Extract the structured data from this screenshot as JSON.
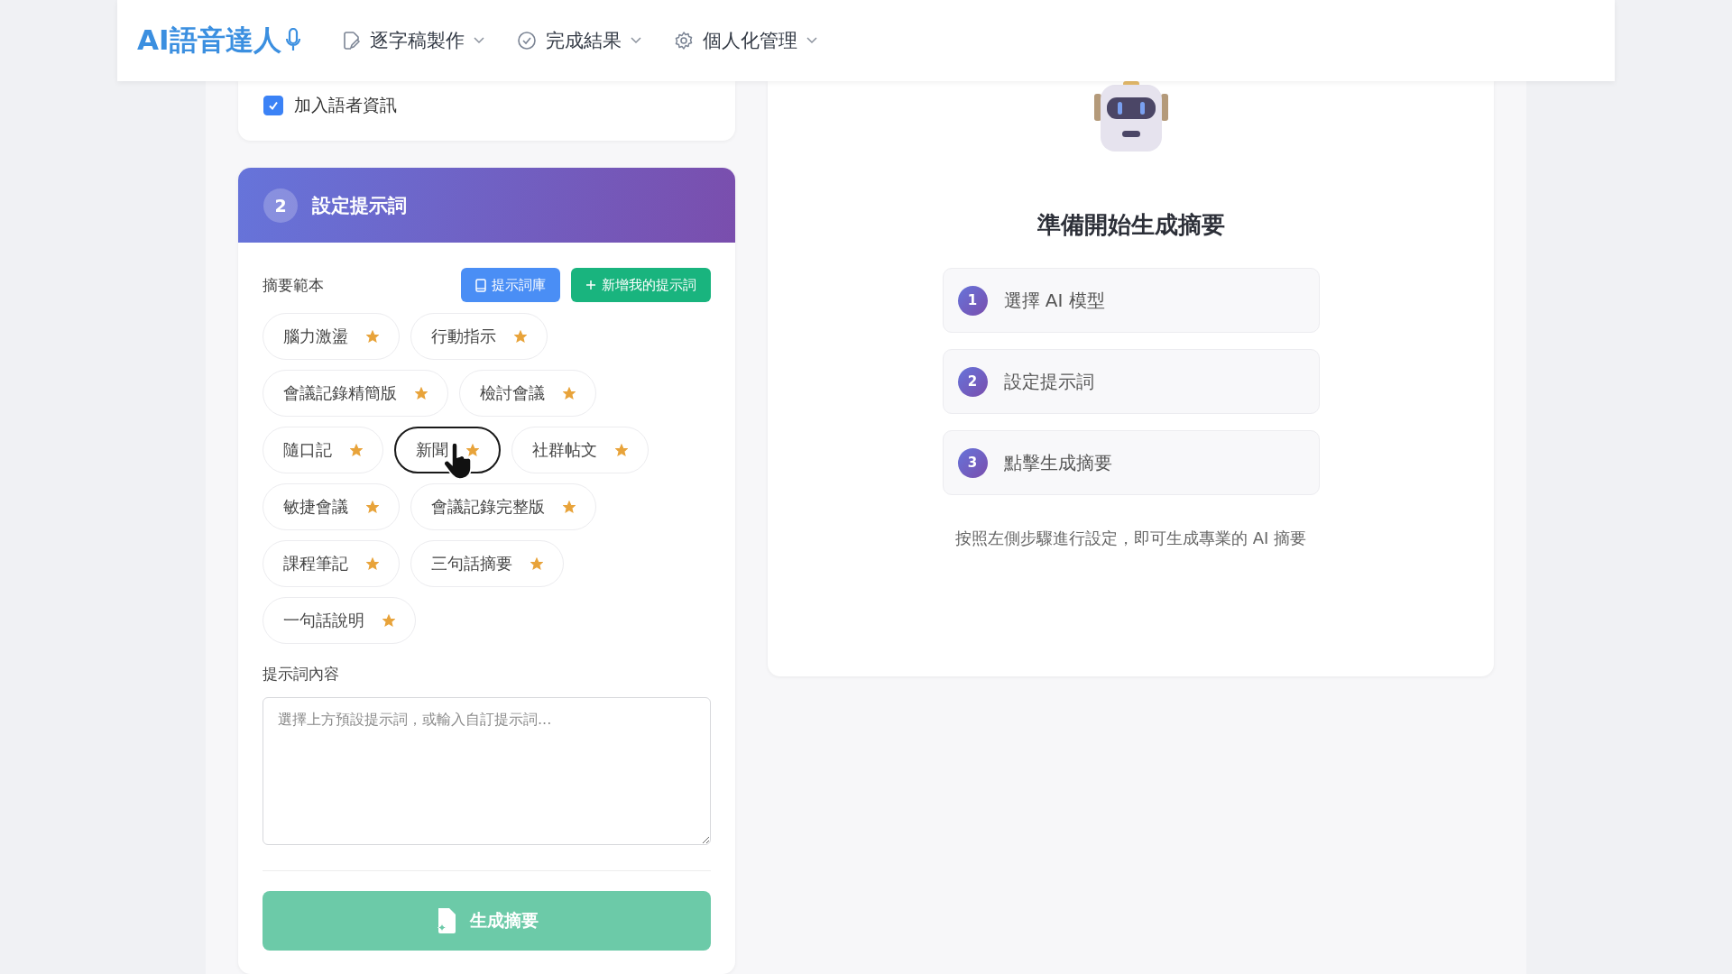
{
  "header": {
    "logo": "AI語音達人",
    "nav": [
      {
        "label": "逐字稿製作"
      },
      {
        "label": "完成結果"
      },
      {
        "label": "個人化管理"
      }
    ]
  },
  "speaker_option": {
    "label": "加入語者資訊",
    "checked": true
  },
  "prompt_section": {
    "step": "2",
    "title": "設定提示詞",
    "templates_label": "摘要範本",
    "library_button": "提示詞庫",
    "add_button": "新增我的提示詞",
    "templates": [
      {
        "label": "腦力激盪",
        "selected": false,
        "starred": true
      },
      {
        "label": "行動指示",
        "selected": false,
        "starred": true
      },
      {
        "label": "會議記錄精簡版",
        "selected": false,
        "starred": true
      },
      {
        "label": "檢討會議",
        "selected": false,
        "starred": true
      },
      {
        "label": "隨口記",
        "selected": false,
        "starred": true
      },
      {
        "label": "新聞",
        "selected": true,
        "starred": true
      },
      {
        "label": "社群帖文",
        "selected": false,
        "starred": true
      },
      {
        "label": "敏捷會議",
        "selected": false,
        "starred": true
      },
      {
        "label": "會議記錄完整版",
        "selected": false,
        "starred": true
      },
      {
        "label": "課程筆記",
        "selected": false,
        "starred": true
      },
      {
        "label": "三句話摘要",
        "selected": false,
        "starred": true
      },
      {
        "label": "一句話說明",
        "selected": false,
        "starred": true
      }
    ],
    "content_label": "提示詞內容",
    "content_placeholder": "選擇上方預設提示詞，或輸入自訂提示詞...",
    "generate_button": "生成摘要"
  },
  "guide": {
    "title": "準備開始生成摘要",
    "steps": [
      {
        "number": "1",
        "label": "選擇 AI 模型"
      },
      {
        "number": "2",
        "label": "設定提示詞"
      },
      {
        "number": "3",
        "label": "點擊生成摘要"
      }
    ],
    "hint": "按照左側步驟進行設定，即可生成專業的 AI 摘要"
  }
}
